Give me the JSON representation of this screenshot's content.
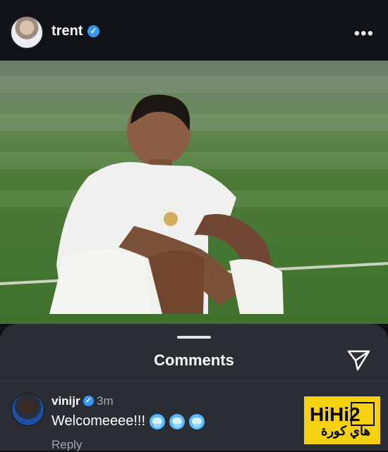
{
  "post": {
    "username": "trent",
    "more_label": "•••"
  },
  "comments_sheet": {
    "title": "Comments"
  },
  "comment": {
    "username": "vinijr",
    "time": "3m",
    "text": "Welcomeeee!!!",
    "reply_label": "Reply",
    "emoji_icons": [
      "cold-face-icon",
      "cold-face-icon",
      "cold-face-icon"
    ]
  },
  "watermark": {
    "latin": "HiHi2",
    "arabic": "هاي كورة"
  },
  "colors": {
    "verified": "#3897f0",
    "sheet": "#2a2d33",
    "watermark": "#f5d10f"
  }
}
